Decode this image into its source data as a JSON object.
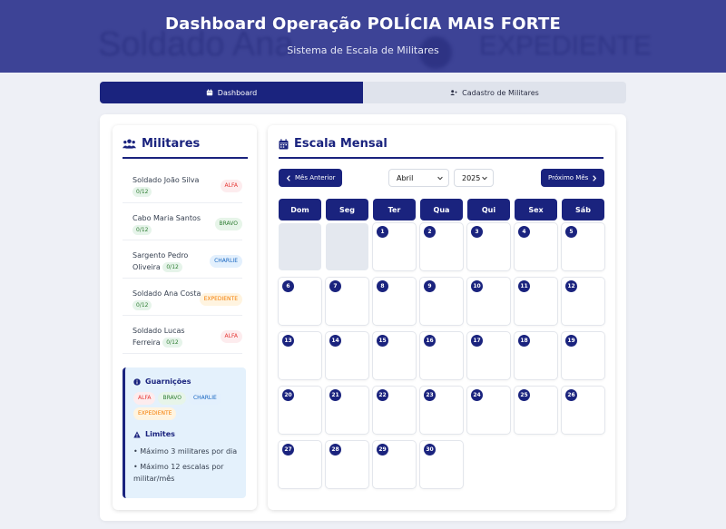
{
  "header": {
    "title": "Dashboard Operação POLÍCIA MAIS FORTE",
    "subtitle": "Sistema de Escala de Militares",
    "ghost_left": "Soldado Ana",
    "ghost_right": "EXPEDIENTE"
  },
  "tabs": [
    {
      "label": "Dashboard",
      "icon": "calendar-icon",
      "active": true
    },
    {
      "label": "Cadastro de Militares",
      "icon": "user-plus-icon",
      "active": false
    }
  ],
  "militares": {
    "title": "Militares",
    "icon": "users-icon",
    "list": [
      {
        "name": "Soldado João Silva",
        "count": "0/12",
        "garrison": "ALFA"
      },
      {
        "name": "Cabo Maria Santos",
        "count": "0/12",
        "garrison": "BRAVO"
      },
      {
        "name": "Sargento Pedro Oliveira",
        "count": "0/12",
        "garrison": "CHARLIE"
      },
      {
        "name": "Soldado Ana Costa",
        "count": "0/12",
        "garrison": "EXPEDIENTE"
      },
      {
        "name": "Soldado Lucas Ferreira",
        "count": "0/12",
        "garrison": "ALFA"
      }
    ],
    "info": {
      "garrisons_title": "Guarnições",
      "garrisons": [
        "ALFA",
        "BRAVO",
        "CHARLIE",
        "EXPEDIENTE"
      ],
      "limits_title": "Limites",
      "limits": [
        "• Máximo 3 militares por dia",
        "• Máximo 12 escalas por militar/mês"
      ]
    }
  },
  "escala": {
    "title": "Escala Mensal",
    "icon": "calendar-icon",
    "prev_label": "Mês Anterior",
    "next_label": "Próximo Mês",
    "month": "Abril",
    "year": "2025",
    "weekdays": [
      "Dom",
      "Seg",
      "Ter",
      "Qua",
      "Qui",
      "Sex",
      "Sáb"
    ],
    "first_weekday_index": 2,
    "days_in_month": 30
  },
  "colors": {
    "primary": "#1a237e",
    "header_bg": "#3d4396",
    "alfa": "#e53935",
    "bravo": "#2e7d32",
    "charlie": "#1565c0",
    "expediente": "#f57c00"
  }
}
